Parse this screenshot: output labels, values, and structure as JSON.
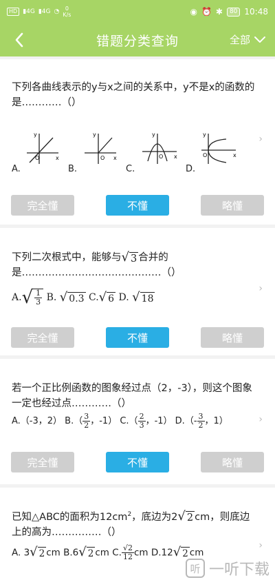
{
  "status": {
    "left_badge": "HD",
    "signal1": "4G",
    "signal2": "4G",
    "speed_value": "0",
    "speed_unit": "K/s",
    "battery": "80",
    "time": "10:48"
  },
  "header": {
    "title": "错题分类查询",
    "filter_label": "全部"
  },
  "buttons": {
    "know": "完全懂",
    "dont_know": "不懂",
    "partial": "略懂"
  },
  "q1": {
    "text": "下列各曲线表示的y与x之间的关系中，y不是x的函数的是…………（）",
    "labels": [
      "A.",
      "B.",
      "C.",
      "D."
    ],
    "axis_y": "y",
    "axis_x": "x",
    "origin": "O"
  },
  "q2": {
    "line1_a": "下列二次根式中，能够与",
    "line1_rad": "3",
    "line1_b": "合并的",
    "line2": "是……………………………………（）",
    "optA": "A.",
    "optA_num": "1",
    "optA_den": "3",
    "optB": "B.",
    "optB_rad": "0.3",
    "optC": "C.",
    "optC_rad": "6",
    "optD": "D.",
    "optD_rad": "18"
  },
  "q3": {
    "text": "若一个正比例函数的图象经过点（2，-3），则这个图象一定也经过点…………（）",
    "a": "A.（-3，2）",
    "b_pre": "B.（",
    "b_num": "3",
    "b_den": "2",
    "b_post": "，-1）",
    "c_pre": "C.（",
    "c_num": "2",
    "c_den": "3",
    "c_post": "，-1）",
    "d_pre": "D.（-",
    "d_num": "3",
    "d_den": "2",
    "d_post": "，1）"
  },
  "q4": {
    "line1_a": "已知△ABC的面积为12cm",
    "line1_sup": "2",
    "line1_b": "，底边为2",
    "line1_rad": "2",
    "line1_c": "cm，则底边",
    "line2": "上的高为……………（）",
    "a_pre": "A. 3",
    "a_rad": "2",
    "a_post": "cm",
    "b_pre": "B.6",
    "b_rad": "2",
    "b_post": "cm",
    "c_pre": "C.",
    "c_num_rad": "2",
    "c_den": "12",
    "c_post": "cm",
    "d_pre": "D.12",
    "d_rad": "2",
    "d_post": "cm"
  },
  "watermark": {
    "logo": "听",
    "text": "一听下载"
  }
}
